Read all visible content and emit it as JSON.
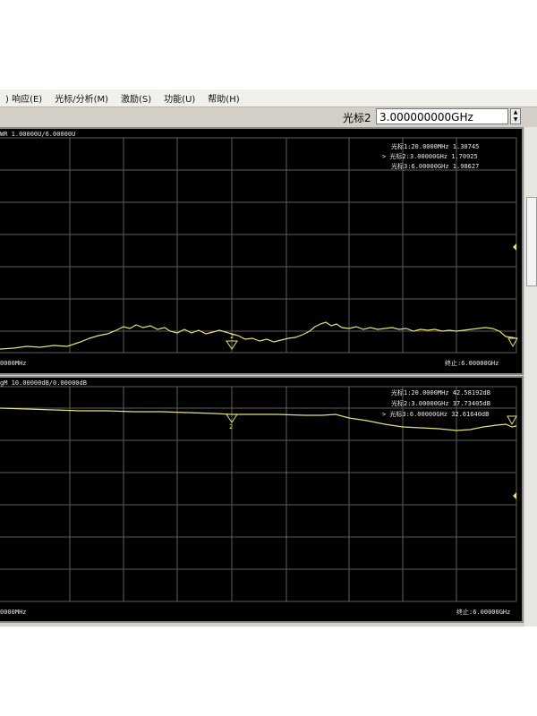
{
  "menu": [
    {
      "label": ") 响应(E)"
    },
    {
      "label": "光标/分析(M)"
    },
    {
      "label": "激励(S)"
    },
    {
      "label": "功能(U)"
    },
    {
      "label": "帮助(H)"
    }
  ],
  "marker_select": {
    "label": "光标2",
    "value": "3.000000000GHz",
    "up": "▲",
    "down": "▼"
  },
  "pane1": {
    "header": "WR 1.00000U/6.00000U",
    "markers": [
      "光标1:20.0000MHz 1.30745",
      "> 光标2:3.00000GHz 1.70925",
      "光标3:6.00000GHz 1.98627"
    ],
    "start": "0000MHz",
    "stop": "终止:6.00000GHz",
    "marker_tag": "2"
  },
  "pane2": {
    "header": "gM 10.00000dB/0.00000dB",
    "markers": [
      "光标1:20.0000MHz 42.58192dB",
      "光标2:3.00000GHz 37.73405dB",
      "> 光标3:6.00000GHz 32.61640dB"
    ],
    "start": "0000MHz",
    "stop": "终止:6.00000GHz",
    "marker_tag": "2"
  },
  "colors": {
    "trace": "#e8e07a",
    "grid": "#666666",
    "text": "#e8e8e8"
  }
}
